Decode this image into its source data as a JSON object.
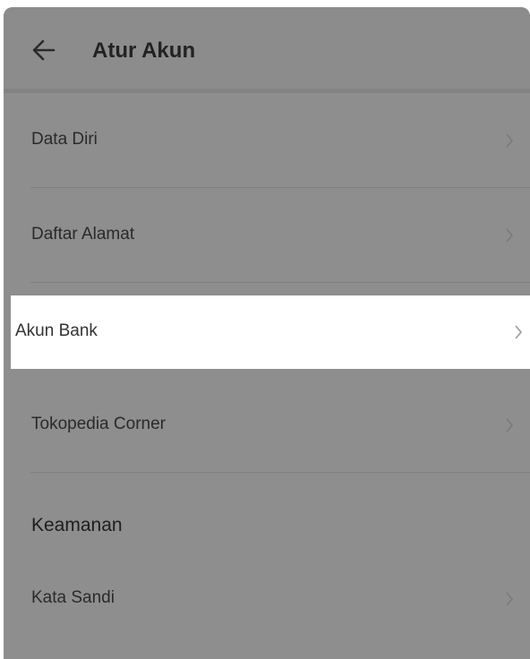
{
  "header": {
    "title": "Atur Akun",
    "back_icon": "arrow-left-icon"
  },
  "items": [
    {
      "label": "Data Diri"
    },
    {
      "label": "Daftar Alamat"
    },
    {
      "label": "Akun Bank"
    },
    {
      "label": "Tokopedia Corner"
    }
  ],
  "sections": [
    {
      "title": "Keamanan",
      "items": [
        {
          "label": "Kata Sandi"
        }
      ]
    }
  ],
  "colors": {
    "overlay": "#8e8e8e",
    "highlight": "#ffffff",
    "text": "#2a2a2a"
  }
}
